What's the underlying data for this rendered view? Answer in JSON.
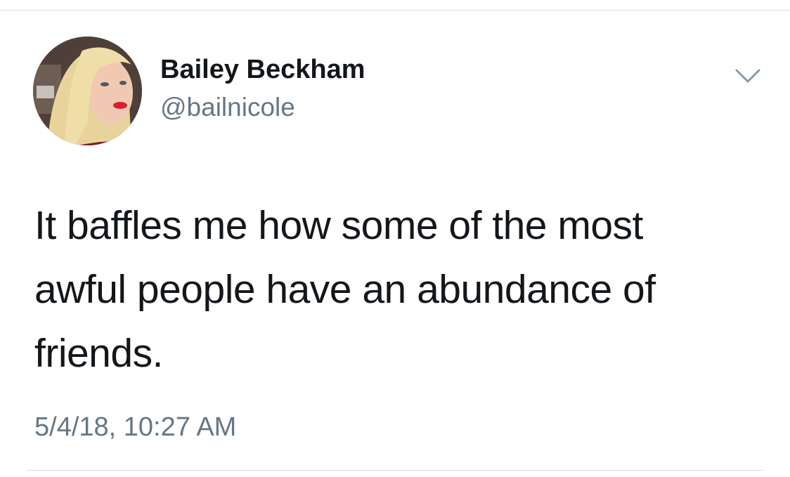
{
  "tweet": {
    "author": {
      "display_name": "Bailey Beckham",
      "handle": "@bailnicole",
      "avatar_icon": "profile-photo"
    },
    "menu_icon": "chevron-down-icon",
    "text_lines": [
      "It baffles me how some of the most",
      "awful people have an abundance of",
      "friends."
    ],
    "timestamp": "5/4/18, 10:27 AM"
  },
  "colors": {
    "primary_text": "#14171a",
    "secondary_text": "#657786",
    "divider": "#d9dde1",
    "background": "#ffffff"
  }
}
